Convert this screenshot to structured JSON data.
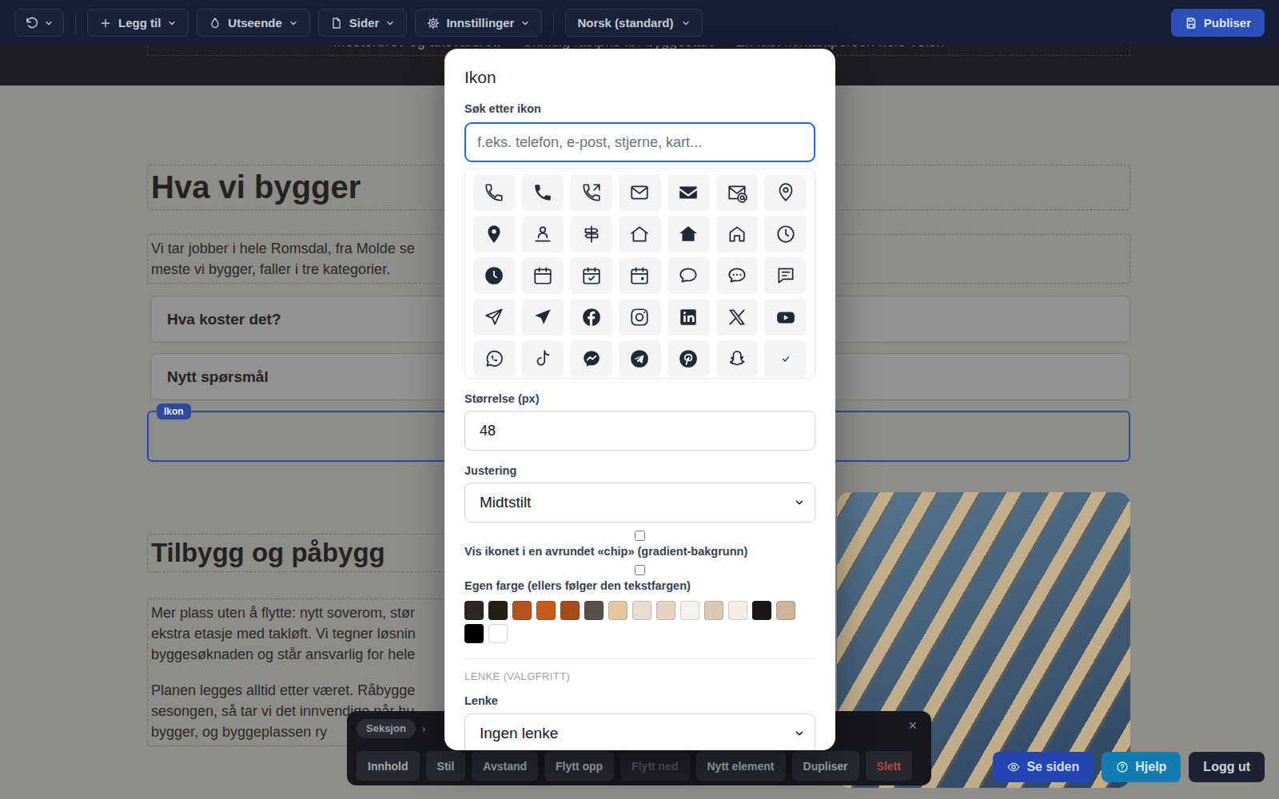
{
  "toolbar": {
    "buttons": [
      {
        "label": "Legg til"
      },
      {
        "label": "Utseende"
      },
      {
        "label": "Sider"
      },
      {
        "label": "Innstillinger"
      }
    ],
    "language": "Norsk (standard)",
    "publish": "Publiser"
  },
  "banner": {
    "items": [
      "Mesterbrev og ansvarsrett",
      "Skriftlig fastpris før byggestart",
      "En fast kontaktperson hele veien"
    ]
  },
  "page": {
    "heading": "Hva vi bygger",
    "intro_lines": [
      "Vi tar jobber i hele Romsdal, fra Molde se",
      "meste vi bygger, faller i tre kategorier."
    ],
    "faq": [
      {
        "question": "Hva koster det?"
      },
      {
        "question": "Nytt spørsmål"
      }
    ],
    "selected_element": {
      "badge": "Ikon",
      "selected": true
    },
    "section": {
      "heading": "Tilbygg og påbygg",
      "paragraphs": [
        [
          "Mer plass uten å flytte: nytt soverom, stør",
          "ekstra etasje med takløft. Vi tegner løsnin",
          "byggesøknaden og står ansvarlig for hele"
        ],
        [
          "Planen legges alltid etter været. Råbygge",
          "sesongen, så tar vi det innvendige når hu",
          "bygger, og byggeplassen ry"
        ]
      ]
    }
  },
  "modal": {
    "title": "Ikon",
    "search": {
      "label": "Søk etter ikon",
      "placeholder": "f.eks. telefon, e-post, stjerne, kart..."
    },
    "icon_options": [
      {
        "selected": false
      },
      {
        "selected": false
      },
      {
        "selected": false
      },
      {
        "selected": false
      },
      {
        "selected": false
      },
      {
        "selected": false
      },
      {
        "selected": false
      },
      {
        "selected": false
      },
      {
        "selected": false
      },
      {
        "selected": false
      },
      {
        "selected": false
      },
      {
        "selected": false
      },
      {
        "selected": false
      },
      {
        "selected": false
      },
      {
        "selected": false
      },
      {
        "selected": false
      },
      {
        "selected": false
      },
      {
        "selected": false
      },
      {
        "selected": false
      },
      {
        "selected": false
      },
      {
        "selected": false
      },
      {
        "selected": false
      },
      {
        "selected": false
      },
      {
        "selected": false
      },
      {
        "selected": false
      },
      {
        "selected": false
      },
      {
        "selected": false
      },
      {
        "selected": false
      },
      {
        "selected": false
      },
      {
        "selected": false
      },
      {
        "selected": false
      },
      {
        "selected": false
      },
      {
        "selected": false
      },
      {
        "selected": false
      },
      {
        "selected": false
      }
    ],
    "size": {
      "label": "Størrelse (px)",
      "value": "48"
    },
    "align": {
      "label": "Justering",
      "value": "Midtstilt"
    },
    "options": [
      {
        "label": "Vis ikonet i en avrundet «chip» (gradient-bakgrunn)",
        "checked": false
      },
      {
        "label": "Egen farge (ellers følger den tekstfargen)",
        "checked": false
      }
    ],
    "swatches": [
      {
        "color": "#2e2620",
        "selected": false
      },
      {
        "color": "#241d14",
        "selected": false
      },
      {
        "color": "#b5531c",
        "selected": false
      },
      {
        "color": "#c85a1a",
        "selected": false
      },
      {
        "color": "#a84a18",
        "selected": false
      },
      {
        "color": "#5a4e48",
        "selected": false
      },
      {
        "color": "#eac6a0",
        "selected": false
      },
      {
        "color": "#e8ddd0",
        "selected": false
      },
      {
        "color": "#e3d3c0",
        "selected": false
      },
      {
        "color": "#f7f3ec",
        "selected": false
      },
      {
        "color": "#dccab0",
        "selected": false
      },
      {
        "color": "#f3ede2",
        "selected": false
      },
      {
        "color": "#1a1714",
        "selected": false
      },
      {
        "color": "#cbb498",
        "selected": false
      },
      {
        "color": "#000000",
        "selected": false
      },
      {
        "color": "#ffffff",
        "selected": false
      }
    ],
    "link_section": "LENKE (VALGFRITT)",
    "link": {
      "label": "Lenke",
      "value": "Ingen lenke"
    }
  },
  "element_toolbar": {
    "breadcrumb": [
      "Seksjon"
    ],
    "separator": "›",
    "close": "×",
    "buttons": [
      {
        "label": "Innhold",
        "disabled": false,
        "kind": "normal"
      },
      {
        "label": "Stil",
        "disabled": false,
        "kind": "normal"
      },
      {
        "label": "Avstand",
        "disabled": false,
        "kind": "normal"
      },
      {
        "label": "Flytt opp",
        "disabled": false,
        "kind": "normal"
      },
      {
        "label": "Flytt ned",
        "disabled": true,
        "kind": "normal"
      },
      {
        "label": "Nytt element",
        "disabled": false,
        "kind": "normal"
      },
      {
        "label": "Dupliser",
        "disabled": false,
        "kind": "normal"
      },
      {
        "label": "Slett",
        "disabled": false,
        "kind": "danger"
      }
    ]
  },
  "corner_buttons": [
    {
      "label": "Se siden"
    },
    {
      "label": "Hjelp"
    },
    {
      "label": "Logg ut"
    }
  ]
}
